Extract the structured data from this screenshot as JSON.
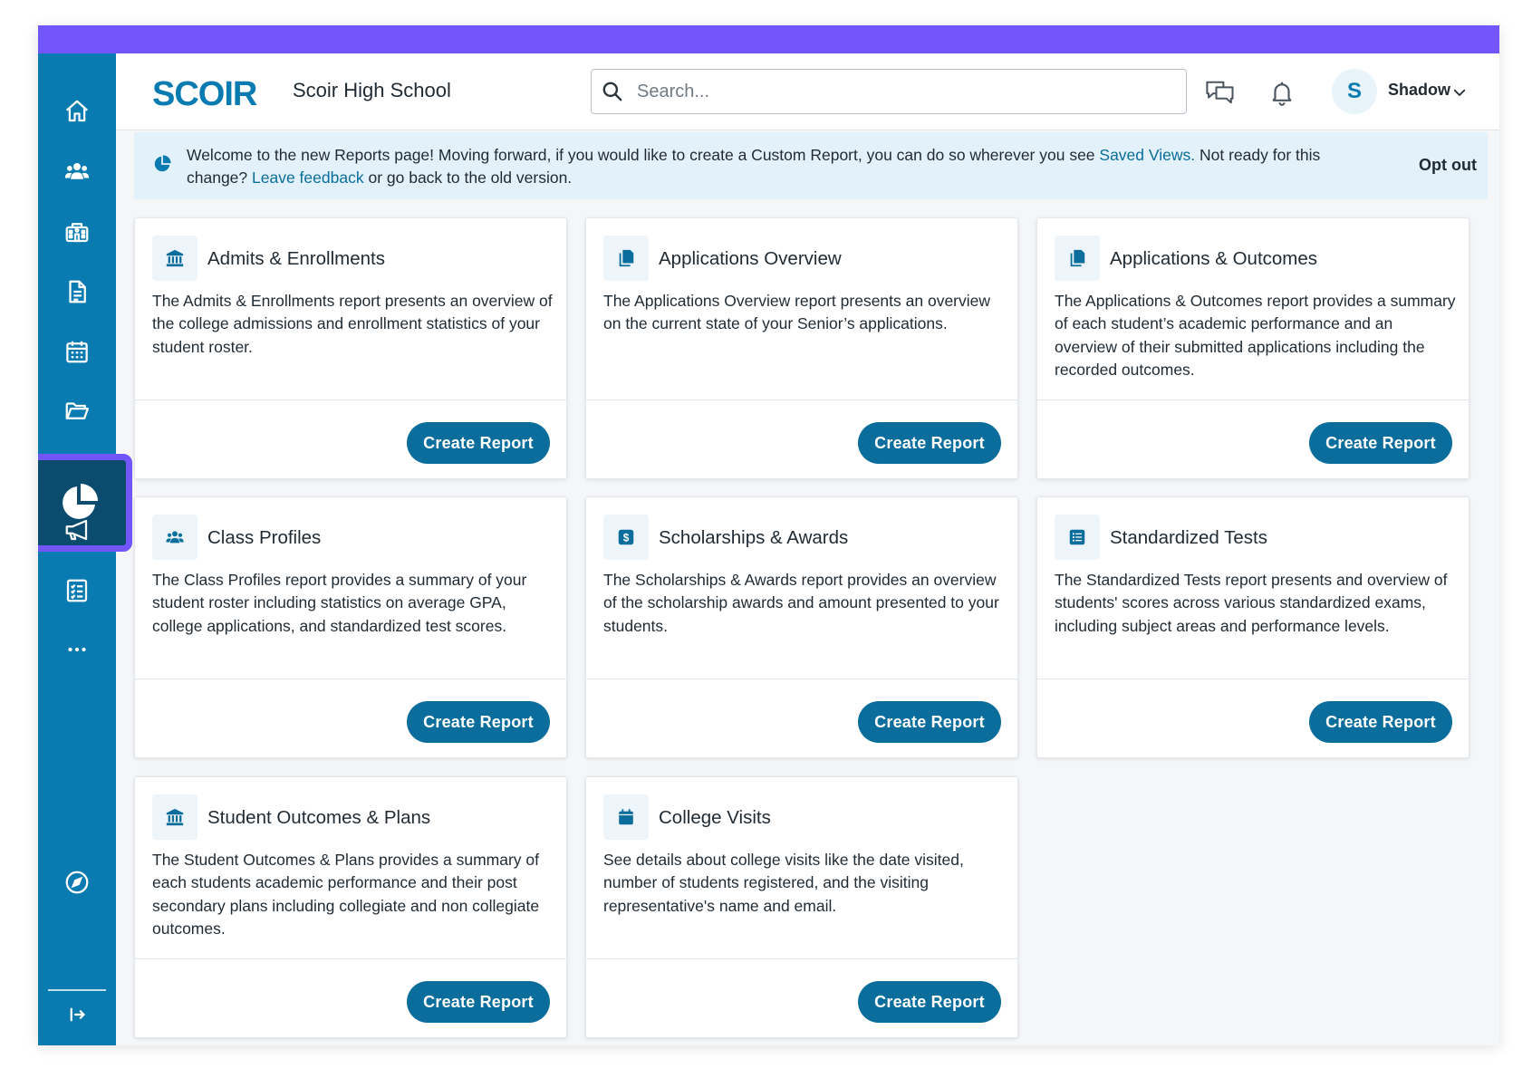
{
  "colors": {
    "accent": "#7356fb",
    "sidebar": "#0a7bb0",
    "sidebar_active": "#0b4c6e",
    "primary_button": "#0a6d9c",
    "banner_bg": "#e3f2fa",
    "link": "#0a6d9c"
  },
  "sidebar": {
    "items": [
      {
        "icon": "home-icon"
      },
      {
        "icon": "people-icon"
      },
      {
        "icon": "school-icon"
      },
      {
        "icon": "document-icon"
      },
      {
        "icon": "calendar-icon"
      },
      {
        "icon": "folder-icon"
      },
      {
        "icon": "pie-chart-icon",
        "active": true
      },
      {
        "icon": "megaphone-icon"
      },
      {
        "icon": "checklist-icon"
      },
      {
        "icon": "more-icon"
      }
    ],
    "bottom": [
      {
        "icon": "compass-icon"
      },
      {
        "icon": "collapse-sidebar-icon"
      }
    ]
  },
  "header": {
    "logo_text": "SCOIR",
    "school_name": "Scoir High School",
    "search_placeholder": "Search...",
    "user_initial": "S",
    "user_name": "Shadow"
  },
  "banner": {
    "text_1": "Welcome to the new Reports page! Moving forward, if you would like to create a Custom Report, you can do so wherever you see ",
    "link_1": "Saved Views.",
    "text_2": " Not ready for this change? ",
    "link_2": "Leave feedback",
    "text_3": " or go back to the old version.",
    "opt_out": "Opt out"
  },
  "reports": [
    {
      "icon": "bank-icon",
      "title": "Admits & Enrollments",
      "description": "The Admits & Enrollments report presents an overview of the college admissions and enrollment statistics of your student roster.",
      "button": "Create Report"
    },
    {
      "icon": "copy-icon",
      "title": "Applications Overview",
      "description": "The Applications Overview report presents an overview on the current state of your Senior’s applications.",
      "button": "Create Report"
    },
    {
      "icon": "copy-icon",
      "title": "Applications & Outcomes",
      "description": "The Applications & Outcomes report provides a summary of each student’s academic performance and an overview of their submitted applications including the recorded outcomes.",
      "button": "Create Report"
    },
    {
      "icon": "people-icon",
      "title": "Class Profiles",
      "description": "The Class Profiles report provides a summary of your student roster including statistics on average GPA, college applications, and standardized test scores.",
      "button": "Create Report"
    },
    {
      "icon": "dollar-icon",
      "title": "Scholarships & Awards",
      "description": "The Scholarships & Awards report provides an overview of the scholarship awards and amount presented to your students.",
      "button": "Create Report"
    },
    {
      "icon": "list-icon",
      "title": "Standardized Tests",
      "description": "The Standardized Tests report presents and overview of students' scores across various standardized exams, including subject areas and performance levels.",
      "button": "Create Report"
    },
    {
      "icon": "bank-icon",
      "title": "Student Outcomes & Plans",
      "description": "The Student Outcomes & Plans provides a summary of each students academic performance and their post secondary plans including collegiate and non collegiate outcomes.",
      "button": "Create Report"
    },
    {
      "icon": "calendar-icon",
      "title": "College Visits",
      "description": "See details about college visits like the date visited, number of students registered, and the visiting representative's name and email.",
      "button": "Create Report"
    }
  ]
}
